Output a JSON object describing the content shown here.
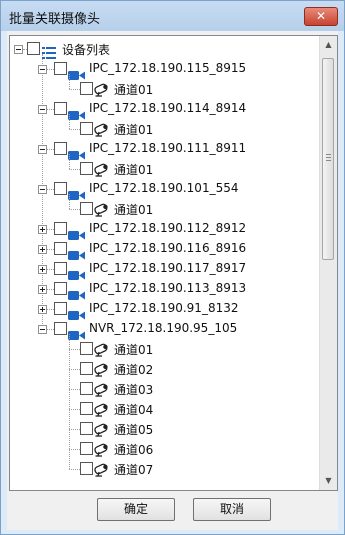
{
  "window": {
    "title": "批量关联摄像头",
    "close_glyph": "✕"
  },
  "tree": {
    "root": {
      "label": "设备列表",
      "icon": "list-icon"
    },
    "devices": [
      {
        "label": "IPC_172.18.190.115_8915",
        "expanded": true,
        "channels": [
          "通道01"
        ]
      },
      {
        "label": "IPC_172.18.190.114_8914",
        "expanded": true,
        "channels": [
          "通道01"
        ]
      },
      {
        "label": "IPC_172.18.190.111_8911",
        "expanded": true,
        "channels": [
          "通道01"
        ]
      },
      {
        "label": "IPC_172.18.190.101_554",
        "expanded": true,
        "channels": [
          "通道01"
        ]
      },
      {
        "label": "IPC_172.18.190.112_8912",
        "expanded": false
      },
      {
        "label": "IPC_172.18.190.116_8916",
        "expanded": false
      },
      {
        "label": "IPC_172.18.190.117_8917",
        "expanded": false
      },
      {
        "label": "IPC_172.18.190.113_8913",
        "expanded": false
      },
      {
        "label": "IPC_172.18.190.91_8132",
        "expanded": false
      },
      {
        "label": "NVR_172.18.190.95_105",
        "expanded": true,
        "channels": [
          "通道01",
          "通道02",
          "通道03",
          "通道04",
          "通道05",
          "通道06",
          "通道07"
        ]
      }
    ],
    "device_icon": "camera-icon",
    "channel_icon": "cctv-channel-icon"
  },
  "buttons": {
    "ok": "确定",
    "cancel": "取消"
  },
  "colors": {
    "camera": "#1f66c2",
    "title_bg": "#c7dcf3",
    "window_bg": "#dcebf7"
  }
}
